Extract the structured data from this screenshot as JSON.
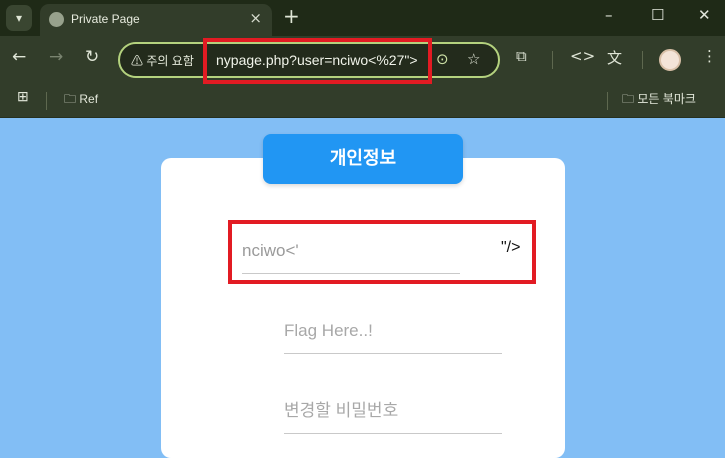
{
  "tab": {
    "title": "Private Page"
  },
  "omnibox": {
    "security_label": "주의 요함",
    "url": "nypage.php?user=nciwo<%27\">"
  },
  "bookmarks": {
    "left_item": "Ref",
    "right_item": "모든 북마크"
  },
  "icons": {
    "tab_menu": "chevron-down-icon",
    "new_tab": "plus-icon",
    "back": "arrow-left-icon",
    "forward": "arrow-right-icon",
    "reload": "reload-icon",
    "warning": "warning-triangle-icon",
    "lens": "lens-icon",
    "star": "star-icon",
    "extensions": "puzzle-icon",
    "devtools": "code-icon",
    "translate": "translate-icon"
  },
  "page": {
    "header": "개인정보",
    "username_value": "nciwo<'",
    "stray_text": "\"/>",
    "flag_placeholder": "Flag Here..!",
    "password_placeholder": "변경할 비밀번호"
  },
  "colors": {
    "page_bg": "#82bef5",
    "header_button": "#2196f3",
    "highlight": "#e21b23",
    "browser_chrome": "#323d2a"
  }
}
